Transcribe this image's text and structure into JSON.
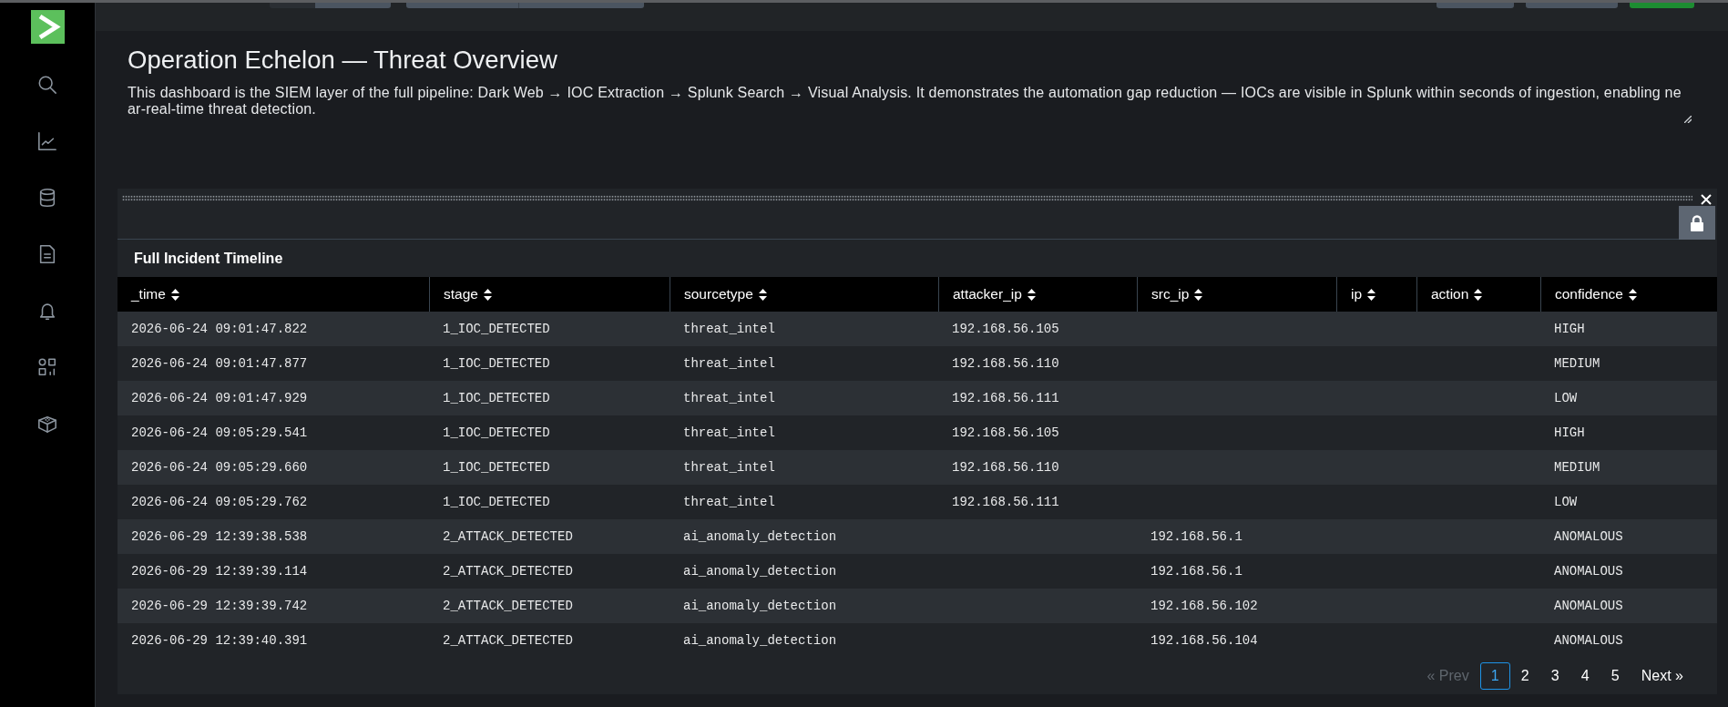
{
  "dashboard": {
    "title": "Operation Echelon — Threat Overview",
    "description": "This dashboard is the SIEM layer of the full pipeline: Dark Web → IOC Extraction → Splunk Search → Visual Analysis. It demonstrates the automation gap reduction — IOCs are visible in Splunk within seconds of ingestion, enabling near-real-time threat detection."
  },
  "panel": {
    "title": "Full Incident Timeline",
    "table": {
      "columns": [
        "_time",
        "stage",
        "sourcetype",
        "attacker_ip",
        "src_ip",
        "ip",
        "action",
        "confidence"
      ],
      "rows": [
        [
          "2026-06-24 09:01:47.822",
          "1_IOC_DETECTED",
          "threat_intel",
          "192.168.56.105",
          null,
          null,
          null,
          "HIGH"
        ],
        [
          "2026-06-24 09:01:47.877",
          "1_IOC_DETECTED",
          "threat_intel",
          "192.168.56.110",
          null,
          null,
          null,
          "MEDIUM"
        ],
        [
          "2026-06-24 09:01:47.929",
          "1_IOC_DETECTED",
          "threat_intel",
          "192.168.56.111",
          null,
          null,
          null,
          "LOW"
        ],
        [
          "2026-06-24 09:05:29.541",
          "1_IOC_DETECTED",
          "threat_intel",
          "192.168.56.105",
          null,
          null,
          null,
          "HIGH"
        ],
        [
          "2026-06-24 09:05:29.660",
          "1_IOC_DETECTED",
          "threat_intel",
          "192.168.56.110",
          null,
          null,
          null,
          "MEDIUM"
        ],
        [
          "2026-06-24 09:05:29.762",
          "1_IOC_DETECTED",
          "threat_intel",
          "192.168.56.111",
          null,
          null,
          null,
          "LOW"
        ],
        [
          "2026-06-29 12:39:38.538",
          "2_ATTACK_DETECTED",
          "ai_anomaly_detection",
          null,
          "192.168.56.1",
          null,
          null,
          "ANOMALOUS"
        ],
        [
          "2026-06-29 12:39:39.114",
          "2_ATTACK_DETECTED",
          "ai_anomaly_detection",
          null,
          "192.168.56.1",
          null,
          null,
          "ANOMALOUS"
        ],
        [
          "2026-06-29 12:39:39.742",
          "2_ATTACK_DETECTED",
          "ai_anomaly_detection",
          null,
          "192.168.56.102",
          null,
          null,
          "ANOMALOUS"
        ],
        [
          "2026-06-29 12:39:40.391",
          "2_ATTACK_DETECTED",
          "ai_anomaly_detection",
          null,
          "192.168.56.104",
          null,
          null,
          "ANOMALOUS"
        ]
      ]
    },
    "pagination": {
      "prev": {
        "label": "« Prev",
        "disabled": true
      },
      "pages": [
        {
          "label": "1",
          "selected": true
        },
        {
          "label": "2",
          "selected": false
        },
        {
          "label": "3",
          "selected": false
        },
        {
          "label": "4",
          "selected": false
        },
        {
          "label": "5",
          "selected": false
        }
      ],
      "next": {
        "label": "Next »",
        "disabled": false
      }
    }
  }
}
